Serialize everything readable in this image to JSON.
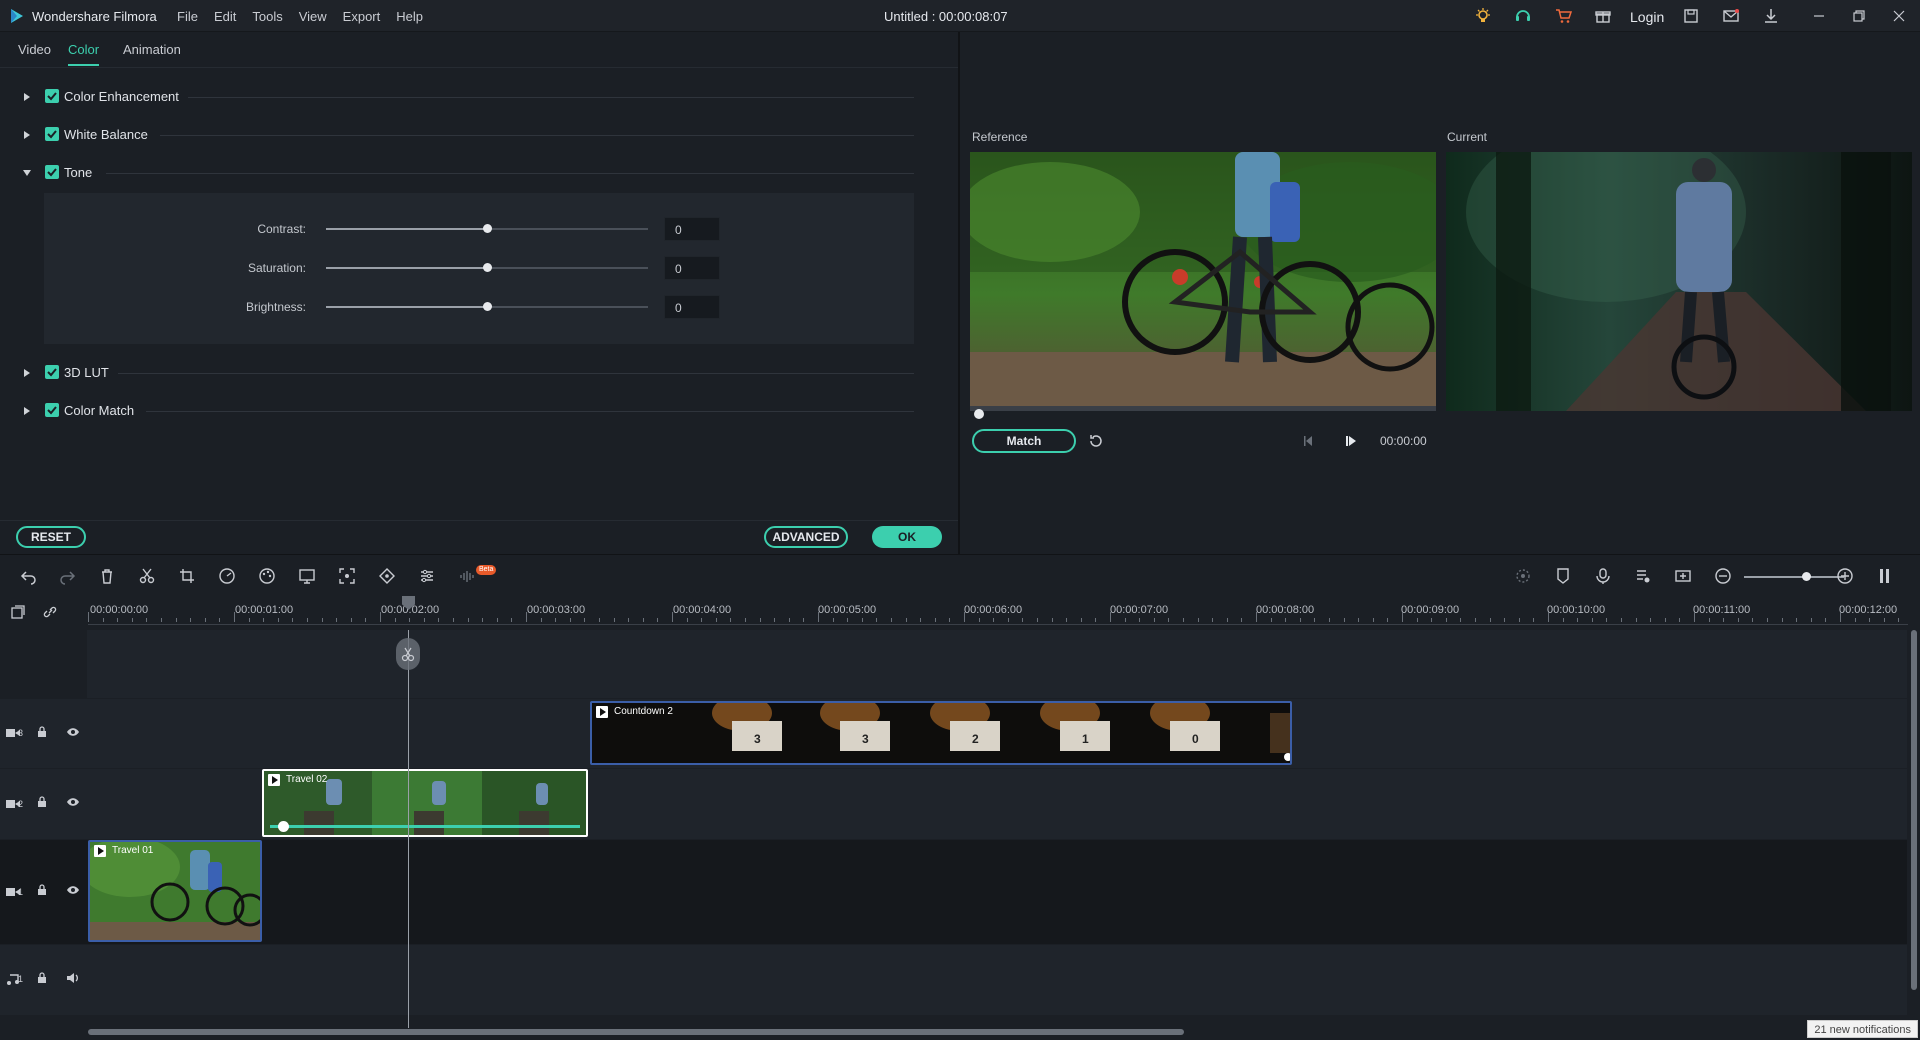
{
  "app": {
    "name": "Wondershare Filmora",
    "menu": [
      "File",
      "Edit",
      "Tools",
      "View",
      "Export",
      "Help"
    ],
    "doc_title": "Untitled : 00:00:08:07",
    "login": "Login"
  },
  "colors": {
    "accent": "#3ccfae",
    "panel": "#1b1f25",
    "clip_border": "#3b5ea8"
  },
  "tabs": [
    {
      "label": "Video"
    },
    {
      "label": "Color",
      "active": true
    },
    {
      "label": "Animation"
    }
  ],
  "sections": {
    "color_enhancement": "Color Enhancement",
    "white_balance": "White Balance",
    "tone": "Tone",
    "lut": "3D LUT",
    "color_match": "Color Match"
  },
  "tone": {
    "contrast": {
      "label": "Contrast:",
      "value": "0",
      "level": 0.5
    },
    "saturation": {
      "label": "Saturation:",
      "value": "0",
      "level": 0.5
    },
    "brightness": {
      "label": "Brightness:",
      "value": "0",
      "level": 0.5
    }
  },
  "buttons": {
    "reset": "RESET",
    "advanced": "ADVANCED",
    "ok": "OK",
    "match": "Match"
  },
  "preview": {
    "reference_label": "Reference",
    "current_label": "Current",
    "time": "00:00:00"
  },
  "ruler": {
    "labels": [
      "00:00:00:00",
      "00:00:01:00",
      "00:00:02:00",
      "00:00:03:00",
      "00:00:04:00",
      "00:00:05:00",
      "00:00:06:00",
      "00:00:07:00",
      "00:00:08:00",
      "00:00:09:00",
      "00:00:10:00",
      "00:00:11:00",
      "00:00:12:00"
    ]
  },
  "tracks": {
    "v3_label": "3",
    "v2_label": "2",
    "v1_label": "1",
    "a1_label": "1"
  },
  "clips": {
    "countdown": {
      "title": "Countdown 2",
      "numbers": [
        "3",
        "3",
        "2",
        "1",
        "0"
      ]
    },
    "travel02": {
      "title": "Travel 02"
    },
    "travel01": {
      "title": "Travel 01"
    }
  },
  "beta_badge": "Beta",
  "notification": "21 new notifications"
}
